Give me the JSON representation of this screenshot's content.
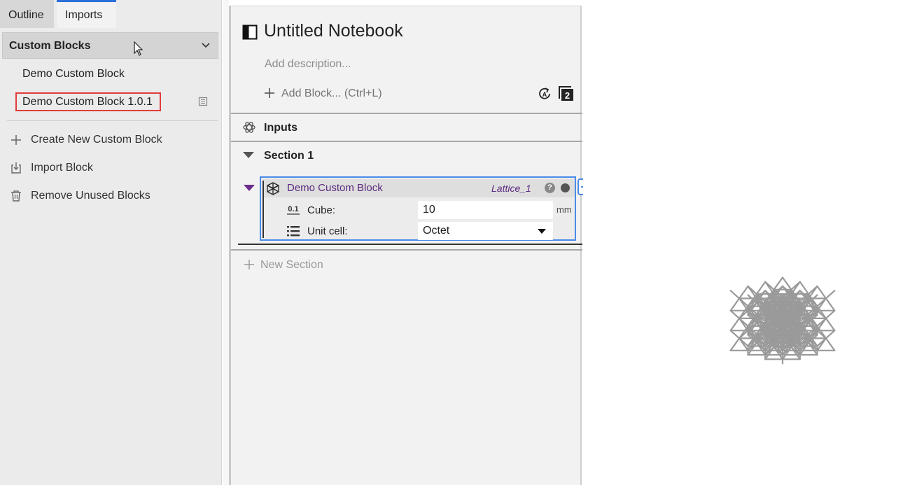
{
  "left_panel": {
    "tabs": [
      {
        "label": "Outline"
      },
      {
        "label": "Imports"
      }
    ],
    "group_title": "Custom Blocks",
    "items": [
      {
        "label": "Demo Custom Block"
      },
      {
        "label": "Demo Custom Block 1.0.1"
      }
    ],
    "actions": [
      {
        "label": "Create New Custom Block",
        "icon": "plus-icon"
      },
      {
        "label": "Import Block",
        "icon": "import-icon"
      },
      {
        "label": "Remove Unused Blocks",
        "icon": "trash-icon"
      }
    ]
  },
  "notebook": {
    "title": "Untitled Notebook",
    "description_placeholder": "Add description...",
    "add_block_label": "Add Block... (Ctrl+L)",
    "inputs_label": "Inputs",
    "section_label": "Section 1",
    "block": {
      "title": "Demo Custom Block",
      "ref_name": "Lattice_1",
      "help_glyph": "?",
      "params": [
        {
          "label": "Cube:",
          "value": "10",
          "unit": "mm",
          "icon": "number-icon"
        },
        {
          "label": "Unit cell:",
          "value": "Octet",
          "unit": "",
          "icon": "list-icon"
        }
      ]
    },
    "new_section_label": "New Section"
  },
  "colors": {
    "accent_blue": "#4a8be8",
    "selection_red": "#e23b3b",
    "block_purple": "#5b2a7e"
  }
}
